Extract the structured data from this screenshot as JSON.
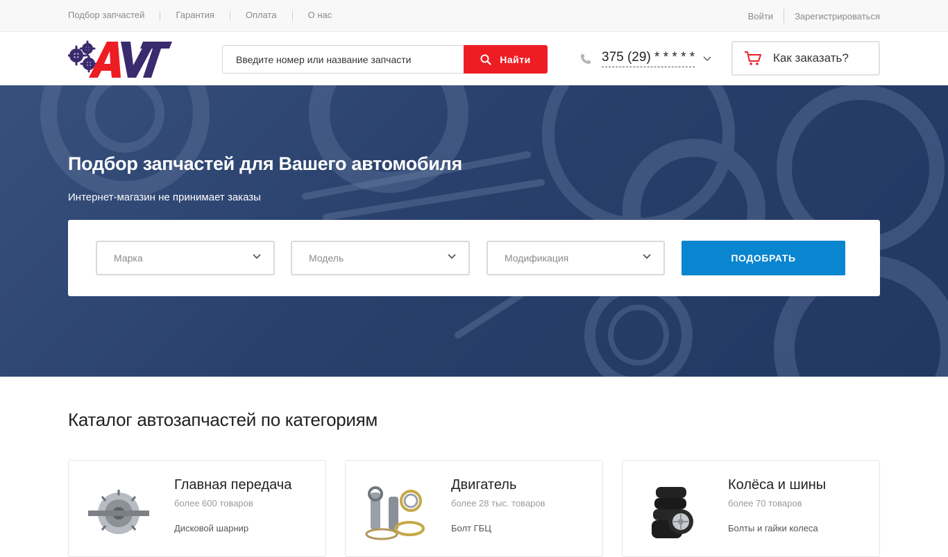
{
  "topnav": {
    "items": [
      "Подбор запчастей",
      "Гарантия",
      "Оплата",
      "О нас"
    ],
    "login": "Войти",
    "register": "Зарегистрироваться"
  },
  "header": {
    "search_placeholder": "Введите номер или название запчасти",
    "search_button": "Найти",
    "phone": "375 (29) * * * * *",
    "how_to_order": "Как заказать?"
  },
  "hero": {
    "title": "Подбор запчастей для Вашего автомобиля",
    "subtitle": "Интернет-магазин не принимает заказы",
    "make_placeholder": "Марка",
    "model_placeholder": "Модель",
    "mod_placeholder": "Модификация",
    "pick_button": "ПОДОБРАТЬ"
  },
  "catalog": {
    "title": "Каталог автозапчастей по категориям",
    "cards": [
      {
        "name": "Главная передача",
        "count": "более 600 товаров",
        "link": "Дисковой шарнир",
        "icon": "gearbox-icon"
      },
      {
        "name": "Двигатель",
        "count": "более 28 тыс. товаров",
        "link": "Болт ГБЦ",
        "icon": "engine-parts-icon"
      },
      {
        "name": "Колёса и шины",
        "count": "более 70 товаров",
        "link": "Болты и гайки колеса",
        "icon": "tires-icon"
      }
    ]
  },
  "colors": {
    "accent_red": "#ee1d24",
    "accent_blue": "#0a85cf",
    "logo_purple": "#3a2a6e"
  }
}
